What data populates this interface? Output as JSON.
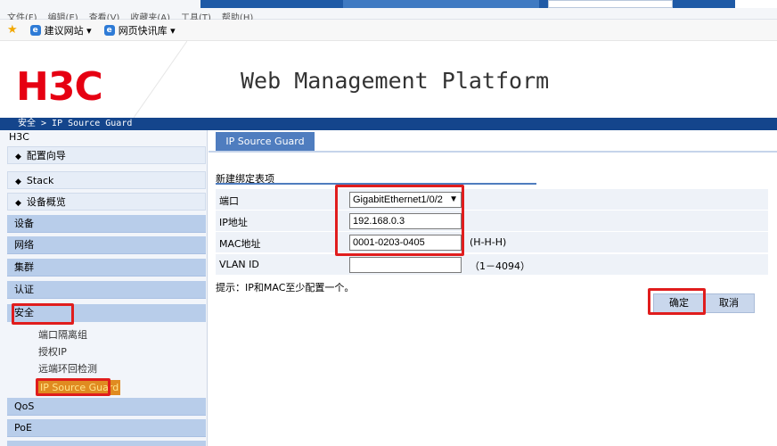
{
  "browser": {
    "menu": [
      "文件(F)",
      "编辑(E)",
      "查看(V)",
      "收藏夹(A)",
      "工具(T)",
      "帮助(H)"
    ],
    "favorites": [
      {
        "label": "建议网站 ▾"
      },
      {
        "label": "网页快讯库 ▾"
      }
    ]
  },
  "header": {
    "logo": "H3C",
    "title": "Web Management Platform"
  },
  "breadcrumb": "安全 > IP Source Guard",
  "sidebar": {
    "root": "H3C",
    "quick": [
      {
        "label": "配置向导"
      },
      {
        "label": "Stack"
      },
      {
        "label": "设备概览"
      }
    ],
    "categories": [
      {
        "label": "设备"
      },
      {
        "label": "网络"
      },
      {
        "label": "集群"
      },
      {
        "label": "认证"
      },
      {
        "label": "安全"
      }
    ],
    "security_sub": [
      {
        "label": "端口隔离组"
      },
      {
        "label": "授权IP"
      },
      {
        "label": "远端环回检测"
      },
      {
        "label": "IP Source Guard"
      }
    ],
    "after": [
      {
        "label": "QoS"
      },
      {
        "label": "PoE"
      }
    ]
  },
  "main": {
    "tab": "IP Source Guard",
    "section_title": "新建绑定表项",
    "fields": {
      "port": {
        "label": "端口",
        "value": "GigabitEthernet1/0/2"
      },
      "ip": {
        "label": "IP地址",
        "value": "192.168.0.3"
      },
      "mac": {
        "label": "MAC地址",
        "value": "0001-0203-0405",
        "hint": "(H-H-H)"
      },
      "vlan": {
        "label": "VLAN ID",
        "value": "",
        "hint": "（1－4094）"
      }
    },
    "note": "提示：IP和MAC至少配置一个。",
    "ok_label": "确定",
    "cancel_label": "取消"
  },
  "colors": {
    "brand_red": "#e60012",
    "nav_blue": "#14458c",
    "tab_blue": "#4f7dbf",
    "highlight_red": "#e01d1d"
  }
}
